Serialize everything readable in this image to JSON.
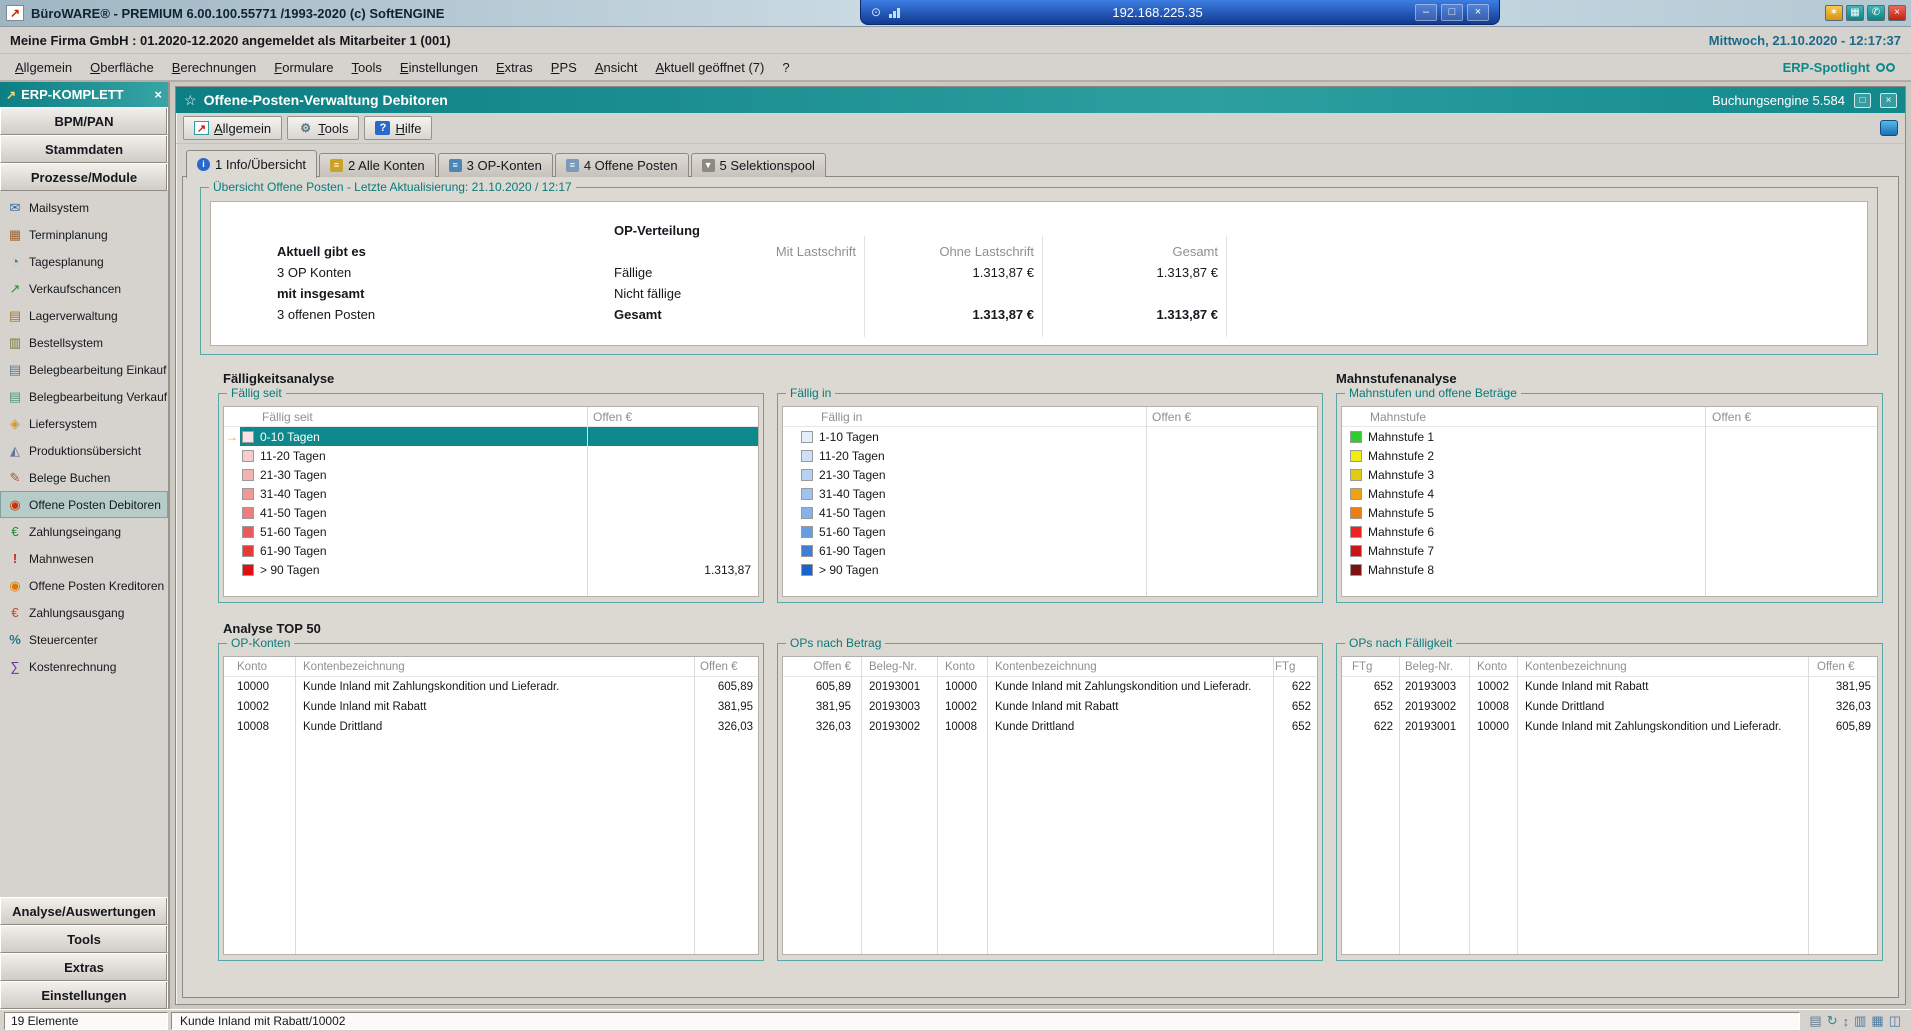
{
  "titlebar": {
    "title": "BüroWARE® - PREMIUM  6.00.100.55771 /1993-2020 (c) SoftENGINE",
    "rdp_address": "192.168.225.35"
  },
  "infobar": {
    "company": "Meine Firma GmbH : 01.2020-12.2020 angemeldet als Mitarbeiter 1 (001)",
    "datetime": "Mittwoch, 21.10.2020 - 12:17:37"
  },
  "menubar": {
    "items": [
      "Allgemein",
      "Oberfläche",
      "Berechnungen",
      "Formulare",
      "Tools",
      "Einstellungen",
      "Extras",
      "PPS",
      "Ansicht",
      "Aktuell geöffnet (7)",
      "?"
    ],
    "spotlight": "ERP-Spotlight"
  },
  "sidebar": {
    "header": "ERP-KOMPLETT",
    "top_sections": [
      "BPM/PAN",
      "Stammdaten",
      "Prozesse/Module"
    ],
    "modules": [
      {
        "label": "Mailsystem",
        "glyph": "✉",
        "color": "#336699"
      },
      {
        "label": "Terminplanung",
        "glyph": "▦",
        "color": "#996633"
      },
      {
        "label": "Tagesplanung",
        "glyph": "◔",
        "color": "#337799"
      },
      {
        "label": "Verkaufschancen",
        "glyph": "↗",
        "color": "#229922"
      },
      {
        "label": "Lagerverwaltung",
        "glyph": "▤",
        "color": "#aa7722"
      },
      {
        "label": "Bestellsystem",
        "glyph": "▥",
        "color": "#777733"
      },
      {
        "label": "Belegbearbeitung Einkauf",
        "glyph": "▤",
        "color": "#557799"
      },
      {
        "label": "Belegbearbeitung Verkauf",
        "glyph": "▤",
        "color": "#559977"
      },
      {
        "label": "Liefersystem",
        "glyph": "◈",
        "color": "#cc9933"
      },
      {
        "label": "Produktionsübersicht",
        "glyph": "◭",
        "color": "#667799"
      },
      {
        "label": "Belege Buchen",
        "glyph": "✎",
        "color": "#aa5533"
      },
      {
        "label": "Offene Posten Debitoren",
        "glyph": "◉",
        "color": "#cc3300",
        "selected": true
      },
      {
        "label": "Zahlungseingang",
        "glyph": "€",
        "color": "#228833"
      },
      {
        "label": "Mahnwesen",
        "glyph": "!",
        "color": "#cc2222"
      },
      {
        "label": "Offene Posten Kreditoren",
        "glyph": "◉",
        "color": "#dd7700"
      },
      {
        "label": "Zahlungsausgang",
        "glyph": "€",
        "color": "#cc4422"
      },
      {
        "label": "Steuercenter",
        "glyph": "%",
        "color": "#227788"
      },
      {
        "label": "Kostenrechnung",
        "glyph": "∑",
        "color": "#663399"
      }
    ],
    "bottom_sections": [
      "Analyse/Auswertungen",
      "Tools",
      "Extras",
      "Einstellungen"
    ]
  },
  "window": {
    "caption": "Offene-Posten-Verwaltung Debitoren",
    "engine": "Buchungsengine 5.584",
    "toolbar": [
      {
        "label": "Allgemein",
        "glyph": "↗"
      },
      {
        "label": "Tools",
        "glyph": "⚙"
      },
      {
        "label": "Hilfe",
        "glyph": "?"
      }
    ],
    "tabs": [
      {
        "label": "1 Info/Übersicht",
        "glyph": "i",
        "color": "#2968cc"
      },
      {
        "label": "2 Alle Konten",
        "glyph": "≡",
        "color": "#c9a227"
      },
      {
        "label": "3 OP-Konten",
        "glyph": "≡",
        "color": "#4a86b8"
      },
      {
        "label": "4 Offene Posten",
        "glyph": "≡",
        "color": "#7a9ab8"
      },
      {
        "label": "5 Selektionspool",
        "glyph": "▼",
        "color": "#8a8a82"
      }
    ]
  },
  "overview": {
    "title": "Übersicht Offene Posten - Letzte Aktualisierung: 21.10.2020 / 12:17",
    "dist_header": "OP-Verteilung",
    "cols": [
      "Mit Lastschrift",
      "Ohne Lastschrift",
      "Gesamt"
    ],
    "rows_left": [
      "Aktuell gibt es",
      "3 OP Konten",
      "mit insgesamt",
      "3 offenen Posten"
    ],
    "rows_mid": [
      "Fällige",
      "Nicht fällige",
      "Gesamt"
    ],
    "faellige_ohne": "1.313,87 €",
    "faellige_gesamt": "1.313,87 €",
    "gesamt_ohne": "1.313,87 €",
    "gesamt_gesamt": "1.313,87 €"
  },
  "faelligkeit": {
    "title": "Fälligkeitsanalyse",
    "seit": {
      "title": "Fällig seit",
      "col_label": "Fällig seit",
      "col_value": "Offen €",
      "rows": [
        {
          "label": "0-10 Tagen",
          "value": "",
          "color": "#f7e3e3",
          "selected": true
        },
        {
          "label": "11-20 Tagen",
          "value": "",
          "color": "#f6cccc"
        },
        {
          "label": "21-30 Tagen",
          "value": "",
          "color": "#f3b3b3"
        },
        {
          "label": "31-40 Tagen",
          "value": "",
          "color": "#f09898"
        },
        {
          "label": "41-50 Tagen",
          "value": "",
          "color": "#ee7d7d"
        },
        {
          "label": "51-60 Tagen",
          "value": "",
          "color": "#ea5c5c"
        },
        {
          "label": "61-90 Tagen",
          "value": "",
          "color": "#e63a3a"
        },
        {
          "label": "> 90 Tagen",
          "value": "1.313,87",
          "color": "#e01010"
        }
      ]
    },
    "in": {
      "title": "Fällig in",
      "col_label": "Fällig in",
      "col_value": "Offen €",
      "rows": [
        {
          "label": "1-10 Tagen",
          "value": "",
          "color": "#e4edfa"
        },
        {
          "label": "11-20 Tagen",
          "value": "",
          "color": "#cedff6"
        },
        {
          "label": "21-30 Tagen",
          "value": "",
          "color": "#b6d1f2"
        },
        {
          "label": "31-40 Tagen",
          "value": "",
          "color": "#9fc2ee"
        },
        {
          "label": "41-50 Tagen",
          "value": "",
          "color": "#86b2e9"
        },
        {
          "label": "51-60 Tagen",
          "value": "",
          "color": "#659ce2"
        },
        {
          "label": "61-90 Tagen",
          "value": "",
          "color": "#3f7fd8"
        },
        {
          "label": "> 90 Tagen",
          "value": "",
          "color": "#1a63cc"
        }
      ]
    }
  },
  "mahnstufen": {
    "title": "Mahnstufenanalyse",
    "group_title": "Mahnstufen und offene Beträge",
    "col_label": "Mahnstufe",
    "col_value": "Offen €",
    "rows": [
      {
        "label": "Mahnstufe 1",
        "value": "",
        "color": "#2ecc2e"
      },
      {
        "label": "Mahnstufe 2",
        "value": "",
        "color": "#f0ee12"
      },
      {
        "label": "Mahnstufe 3",
        "value": "",
        "color": "#e2cc10"
      },
      {
        "label": "Mahnstufe 4",
        "value": "",
        "color": "#f0a312"
      },
      {
        "label": "Mahnstufe 5",
        "value": "",
        "color": "#ee7d10"
      },
      {
        "label": "Mahnstufe 6",
        "value": "",
        "color": "#ee2222"
      },
      {
        "label": "Mahnstufe 7",
        "value": "",
        "color": "#cc1515"
      },
      {
        "label": "Mahnstufe 8",
        "value": "",
        "color": "#7d1010"
      }
    ]
  },
  "top50": {
    "title": "Analyse TOP 50",
    "konten": {
      "title": "OP-Konten",
      "headers": [
        "Konto",
        "Kontenbezeichnung",
        "Offen €"
      ],
      "rows": [
        {
          "konto": "10000",
          "name": "Kunde Inland mit Zahlungskondition und Lieferadr.",
          "offen": "605,89"
        },
        {
          "konto": "10002",
          "name": "Kunde Inland mit Rabatt",
          "offen": "381,95"
        },
        {
          "konto": "10008",
          "name": "Kunde Drittland",
          "offen": "326,03"
        }
      ]
    },
    "betrag": {
      "title": "OPs nach Betrag",
      "headers": [
        "Offen €",
        "Beleg-Nr.",
        "Konto",
        "Kontenbezeichnung",
        "FTg"
      ],
      "rows": [
        {
          "offen": "605,89",
          "beleg": "20193001",
          "konto": "10000",
          "name": "Kunde Inland mit Zahlungskondition und Lieferadr.",
          "ftg": "622"
        },
        {
          "offen": "381,95",
          "beleg": "20193003",
          "konto": "10002",
          "name": "Kunde Inland mit Rabatt",
          "ftg": "652"
        },
        {
          "offen": "326,03",
          "beleg": "20193002",
          "konto": "10008",
          "name": "Kunde Drittland",
          "ftg": "652"
        }
      ]
    },
    "faellig": {
      "title": "OPs nach Fälligkeit",
      "headers": [
        "FTg",
        "Beleg-Nr.",
        "Konto",
        "Kontenbezeichnung",
        "Offen €"
      ],
      "rows": [
        {
          "ftg": "652",
          "beleg": "20193003",
          "konto": "10002",
          "name": "Kunde Inland mit Rabatt",
          "offen": "381,95"
        },
        {
          "ftg": "652",
          "beleg": "20193002",
          "konto": "10008",
          "name": "Kunde Drittland",
          "offen": "326,03"
        },
        {
          "ftg": "622",
          "beleg": "20193001",
          "konto": "10000",
          "name": "Kunde Inland mit Zahlungskondition und Lieferadr.",
          "offen": "605,89"
        }
      ]
    }
  },
  "statusbar": {
    "count": "19 Elemente",
    "message": "Kunde Inland mit Rabatt/10002",
    "icons": [
      {
        "name": "print-icon",
        "glyph": "▤",
        "color": "#607890"
      },
      {
        "name": "refresh-icon",
        "glyph": "↻",
        "color": "#2a8a8a"
      },
      {
        "name": "sort-icon",
        "glyph": "↕",
        "color": "#4a7aa0"
      },
      {
        "name": "columns-icon",
        "glyph": "▥",
        "color": "#4a7aa0"
      },
      {
        "name": "table-icon",
        "glyph": "▦",
        "color": "#4a7aa0"
      },
      {
        "name": "grid-icon",
        "glyph": "◫",
        "color": "#4a7aa0"
      }
    ]
  },
  "icons": {
    "app_logo": "↗",
    "title_btn1": "✶",
    "title_btn2": "▦",
    "title_btn3": "✆",
    "title_close": "×",
    "rdp_pin": "⊙",
    "rdp_min": "–",
    "rdp_restore": "□",
    "rdp_close": "×",
    "sidebar_logo": "↗",
    "sidebar_close": "×",
    "caption_star": "☆",
    "caption_restore": "□",
    "caption_close": "×",
    "row_marker": "→"
  }
}
